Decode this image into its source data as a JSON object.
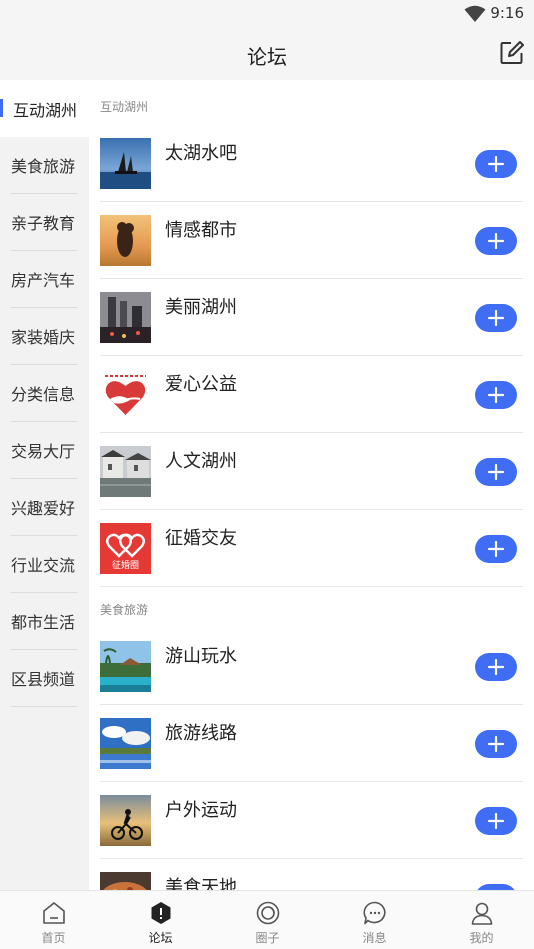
{
  "status_bar": {
    "time": "9:16",
    "wifi_icon": "wifi-icon"
  },
  "app_bar": {
    "title": "论坛",
    "compose_icon": "compose-icon"
  },
  "sidebar": {
    "items": [
      {
        "label": "互动湖州",
        "active": true
      },
      {
        "label": "美食旅游",
        "active": false
      },
      {
        "label": "亲子教育",
        "active": false
      },
      {
        "label": "房产汽车",
        "active": false
      },
      {
        "label": "家装婚庆",
        "active": false
      },
      {
        "label": "分类信息",
        "active": false
      },
      {
        "label": "交易大厅",
        "active": false
      },
      {
        "label": "兴趣爱好",
        "active": false
      },
      {
        "label": "行业交流",
        "active": false
      },
      {
        "label": "都市生活",
        "active": false
      },
      {
        "label": "区县频道",
        "active": false
      }
    ]
  },
  "sections": [
    {
      "title": "互动湖州",
      "forums": [
        {
          "name": "太湖水吧",
          "thumb": "lake-sailboat-photo"
        },
        {
          "name": "情感都市",
          "thumb": "couple-sunset-photo"
        },
        {
          "name": "美丽湖州",
          "thumb": "city-night-photo"
        },
        {
          "name": "爱心公益",
          "thumb": "charity-heart-logo"
        },
        {
          "name": "人文湖州",
          "thumb": "old-town-photo"
        },
        {
          "name": "征婚交友",
          "thumb": "dating-logo",
          "thumb_text": "征婚圈"
        }
      ]
    },
    {
      "title": "美食旅游",
      "forums": [
        {
          "name": "游山玩水",
          "thumb": "resort-pool-photo"
        },
        {
          "name": "旅游线路",
          "thumb": "sky-lake-photo"
        },
        {
          "name": "户外运动",
          "thumb": "cyclist-sunset-photo"
        },
        {
          "name": "美食天地",
          "thumb": "food-photo"
        }
      ]
    }
  ],
  "tabbar": {
    "tabs": [
      {
        "label": "首页",
        "icon": "home-icon",
        "active": false
      },
      {
        "label": "论坛",
        "icon": "forum-icon",
        "active": true
      },
      {
        "label": "圈子",
        "icon": "circle-icon",
        "active": false
      },
      {
        "label": "消息",
        "icon": "message-icon",
        "active": false
      },
      {
        "label": "我的",
        "icon": "profile-icon",
        "active": false
      }
    ]
  },
  "colors": {
    "accent": "#3f6ef4",
    "active_indicator": "#3d6df2",
    "dating_logo": "#e53935"
  }
}
